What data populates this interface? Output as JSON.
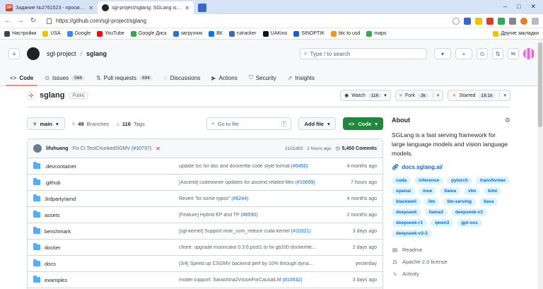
{
  "browser": {
    "tabs": [
      {
        "title": "Задание №2761523 - просмотр з",
        "favicon": "SP",
        "favicon_color": "#d93f2a",
        "active": false
      },
      {
        "title": "sgl-project/sglang: SGLang is a fa",
        "favicon": "",
        "favicon_color": "#1f2328",
        "active": true
      }
    ],
    "url": "https://github.com/sgl-project/sglang",
    "window_controls": {
      "minimize": "–",
      "maximize": "□",
      "close": "✕"
    },
    "bookmarks": [
      {
        "label": "Настройки",
        "color": "#444"
      },
      {
        "label": "USA",
        "color": "#f2c200"
      },
      {
        "label": "Google",
        "color": "#4285f4"
      },
      {
        "label": "YouTube",
        "color": "#ff0000"
      },
      {
        "label": "Google Диск",
        "color": "#34a853"
      },
      {
        "label": "загрузчик",
        "color": "#2d6fe0"
      },
      {
        "label": "ВК",
        "color": "#0077ff"
      },
      {
        "label": "rutracker",
        "color": "#3a6bb7"
      },
      {
        "label": "UAKino",
        "color": "#111"
      },
      {
        "label": "SINOPTIK",
        "color": "#1b5fd6"
      },
      {
        "label": "btc to usd",
        "color": "#f7931a"
      },
      {
        "label": "maps",
        "color": "#34a853"
      }
    ],
    "bookmarks_other": "Другие закладки"
  },
  "gh": {
    "org": "sgl-project",
    "repo": "sglang",
    "search_placeholder": "Type / to search",
    "search_key": "/",
    "tabs": [
      {
        "label": "Code",
        "icon": "<>",
        "count": "",
        "selected": true
      },
      {
        "label": "Issues",
        "icon": "⊙",
        "count": "568",
        "selected": false
      },
      {
        "label": "Pull requests",
        "icon": "⇅",
        "count": "694",
        "selected": false
      },
      {
        "label": "Discussions",
        "icon": "◌",
        "count": "",
        "selected": false
      },
      {
        "label": "Actions",
        "icon": "▶",
        "count": "",
        "selected": false
      },
      {
        "label": "Security",
        "icon": "⛉",
        "count": "",
        "selected": false
      },
      {
        "label": "Insights",
        "icon": "↗",
        "count": "",
        "selected": false
      }
    ]
  },
  "repo": {
    "name": "sglang",
    "visibility": "Public",
    "watch_label": "Watch",
    "watch_count": "116",
    "fork_label": "Fork",
    "fork_count": "3k",
    "star_label": "Starred",
    "star_count": "18.1k"
  },
  "branch": {
    "name": "main",
    "branches_count": "49",
    "branches_label": "Branches",
    "tags_count": "116",
    "tags_label": "Tags",
    "goto_placeholder": "Go to file",
    "goto_key": "t",
    "add_file_label": "Add file",
    "code_label": "Code"
  },
  "commit": {
    "author": "lifuhuang",
    "message": "Fix CI TestChunkedSGMV",
    "pr": "(#10737)",
    "status": "✕",
    "hash_time": "2101d93 · 2 hours ago",
    "count_label": "5,450 Commits"
  },
  "files": [
    {
      "name": ".devcontainer",
      "msg": "update toc for doc and dockerfile code style format ",
      "pr": "(#6450)",
      "date": "4 months ago"
    },
    {
      "name": ".github",
      "msg": "[Ascend] codeowner updates for ascend related files ",
      "pr": "(#10699)",
      "date": "7 hours ago"
    },
    {
      "name": "3rdparty/amd",
      "msg": "Revert \"fix some typos\" ",
      "pr": "(#6244)",
      "date": "4 months ago"
    },
    {
      "name": "assets",
      "msg": "[Feature] Hybrid EP and TP ",
      "pr": "(#8590)",
      "date": "2 months ago"
    },
    {
      "name": "benchmark",
      "msg": "[sgl-kernel] Support moe_sum_reduce cuda kernel ",
      "pr": "(#10321)",
      "date": "3 days ago"
    },
    {
      "name": "docker",
      "msg": "chore: upgrade mooncake 0.3.6.post1 to fix gb200 dockerfile...",
      "pr": "",
      "date": "2 days ago"
    },
    {
      "name": "docs",
      "msg": "[3/4] Speed up CSGMV backend perf by 10% through dyna...",
      "pr": "",
      "date": "yesterday"
    },
    {
      "name": "examples",
      "msg": "model support: Sarashina2VisionForCausalLM ",
      "pr": "(#10632)",
      "date": "3 days ago"
    }
  ],
  "about": {
    "title": "About",
    "description": "SGLang is a fast serving framework for large language models and vision language models.",
    "homepage": "docs.sglang.ai/",
    "topics": [
      "cuda",
      "inference",
      "pytorch",
      "transformer",
      "openai",
      "moe",
      "llama",
      "vlm",
      "kimi",
      "blackwell",
      "llm",
      "llm-serving",
      "llava",
      "deepseek",
      "llama3",
      "deepseek-v3",
      "deepseek-r1",
      "qwen3",
      "gpt-oss",
      "deepseek-v3-2"
    ],
    "readme": "Readme",
    "license": "Apache-2.0 license",
    "activity": "Activity"
  }
}
